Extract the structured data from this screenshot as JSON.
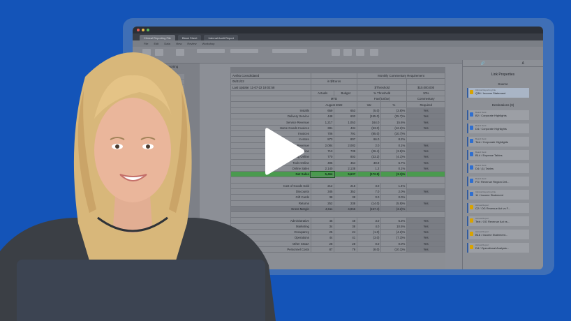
{
  "window": {
    "tabs": [
      "Clinical Reporting File",
      "Blank Sheet",
      "Internal Audit Report"
    ],
    "menu": [
      "File",
      "Edit",
      "Data",
      "View",
      "Review",
      "Workshop"
    ],
    "left_panel_title": "Clinical Reporting File"
  },
  "sheet": {
    "entity": "Avrika Consolidated",
    "date": "06/31/22",
    "last_update": "Last Update: 11-07-22 19:02:58",
    "unit": "in $/Euros",
    "commentary_title": "Monthly Commentary Requirement",
    "threshold_label": "$Threshold",
    "threshold_value": "$10,000,000",
    "pct_threshold_label": "% Threshold",
    "pct_threshold_value": "10%",
    "fav_label": "Fav/(Unfav)",
    "commentary_label": "Commentary",
    "required_label": "Required",
    "actuals": "Actuals",
    "budget": "Budget",
    "mtd": "MTD",
    "period": "August 2022",
    "var": "Var",
    "pct": "%",
    "rows": [
      {
        "label": "Installs",
        "a": "659",
        "b": "653",
        "v": "(5.0)",
        "p": "(3.8)%",
        "req": "Yes"
      },
      {
        "label": "Delivery Service",
        "a": "448",
        "b": "603",
        "v": "(155.0)",
        "p": "(25.7)%",
        "req": "Yes"
      },
      {
        "label": "Service Revenue",
        "a": "1,217",
        "b": "1,053",
        "v": "164.0",
        "p": "15.6%",
        "req": "Yes"
      },
      {
        "label": "Home Goods Invoices",
        "a": "381",
        "b": "434",
        "v": "(53.0)",
        "p": "(12.2)%",
        "req": "Yes"
      },
      {
        "label": "Invoices",
        "a": "706",
        "b": "791",
        "v": "(85.0)",
        "p": "(10.7)%",
        "req": ""
      },
      {
        "label": "In-store",
        "a": "873",
        "b": "807",
        "v": "66.0",
        "p": "8.2%",
        "req": ""
      },
      {
        "label": "Revenue",
        "a": "2,084",
        "b": "2,082",
        "v": "2.0",
        "p": "0.1%",
        "req": "Yes"
      },
      {
        "label": "Online",
        "a": "713",
        "b": "739",
        "v": "(26.4)",
        "p": "(3.6)%",
        "req": "Yes"
      },
      {
        "label": "Clothing Online",
        "a": "770",
        "b": "803",
        "v": "(33.2)",
        "p": "(4.1)%",
        "req": "Yes"
      },
      {
        "label": "Tools Online",
        "a": "495",
        "b": "464",
        "v": "30.9",
        "p": "6.7%",
        "req": "Yes"
      },
      {
        "label": "Online Sales",
        "a": "2,140",
        "b": "2,138",
        "v": "1.2",
        "p": "0.1%",
        "req": "Yes"
      }
    ],
    "net_sales": {
      "label": "Net Sales",
      "a": "5,464",
      "b": "5,637",
      "v": "(172.8)",
      "p": "(3.1)%"
    },
    "cogs_rows": [
      {
        "label": "Cost of Goods Sold",
        "a": "212",
        "b": "215",
        "v": "3.0",
        "p": "1.4%",
        "req": ""
      },
      {
        "label": "Discounts",
        "a": "345",
        "b": "352",
        "v": "7.0",
        "p": "2.0%",
        "req": "Yes"
      },
      {
        "label": "Gift Cards",
        "a": "38",
        "b": "38",
        "v": "0.0",
        "p": "0.0%",
        "req": ""
      },
      {
        "label": "Returns",
        "a": "252",
        "b": "238",
        "v": "(14.0)",
        "p": "(5.9)%",
        "req": "Yes"
      }
    ],
    "gross_margin": {
      "label": "Gross Margin",
      "a": "4,611",
      "b": "4,966",
      "v": "(157.4)",
      "p": "(3.2)%"
    },
    "opex_rows": [
      {
        "label": "Administrative",
        "a": "45",
        "b": "48",
        "v": "3.0",
        "p": "6.3%",
        "req": "Yes"
      },
      {
        "label": "Marketing",
        "a": "34",
        "b": "38",
        "v": "4.0",
        "p": "10.5%",
        "req": "Yes"
      },
      {
        "label": "Occupancy",
        "a": "25",
        "b": "24",
        "v": "(1.0)",
        "p": "(4.2)%",
        "req": "Yes"
      },
      {
        "label": "Operations",
        "a": "44",
        "b": "41",
        "v": "(3.0)",
        "p": "(7.3)%",
        "req": "Yes"
      },
      {
        "label": "Other SG&A",
        "a": "28",
        "b": "28",
        "v": "0.0",
        "p": "0.0%",
        "req": "Yes"
      },
      {
        "label": "Personnel Costs",
        "a": "87",
        "b": "79",
        "v": "(8.0)",
        "p": "(10.1)%",
        "req": "Yes"
      }
    ]
  },
  "link_properties": {
    "title": "Link Properties",
    "source_label": "Source",
    "source": {
      "file": "Clinical Reporting File",
      "link": "Q36 / Income Statement"
    },
    "destinations_label": "Destinations (9)",
    "destinations": [
      {
        "file": "Board Deck",
        "link": "B2 / Corporate Highlights",
        "color": "#2f6fd0"
      },
      {
        "file": "Board Deck",
        "link": "D4 / Corporate Highlights",
        "color": "#2f6fd0"
      },
      {
        "file": "Board Deck",
        "link": "Text / Corporate Highlights",
        "color": "#2f6fd0"
      },
      {
        "file": "Board Deck",
        "link": "B14 / Expense Tables",
        "color": "#2f6fd0"
      },
      {
        "file": "Board Deck",
        "link": "D4 / (1) Tables",
        "color": "#2f6fd0"
      },
      {
        "file": "Board Deck",
        "link": "F3 / Revenue Region Det...",
        "color": "#2f6fd0"
      },
      {
        "file": "Clinical Reporting File",
        "link": "11 / Income Statement",
        "color": "#2f6fd0"
      },
      {
        "file": "Annual Report",
        "link": "C2 / OG Revenue Act vs F...",
        "color": "#d9a300"
      },
      {
        "file": "Annual Report",
        "link": "Text / OG Revenue Act vs...",
        "color": "#d9a300"
      },
      {
        "file": "Annual Report",
        "link": "B16 / Income Statement...",
        "color": "#d9a300"
      },
      {
        "file": "Annual Report",
        "link": "D4 / Operational Analysis...",
        "color": "#d9a300"
      }
    ]
  }
}
